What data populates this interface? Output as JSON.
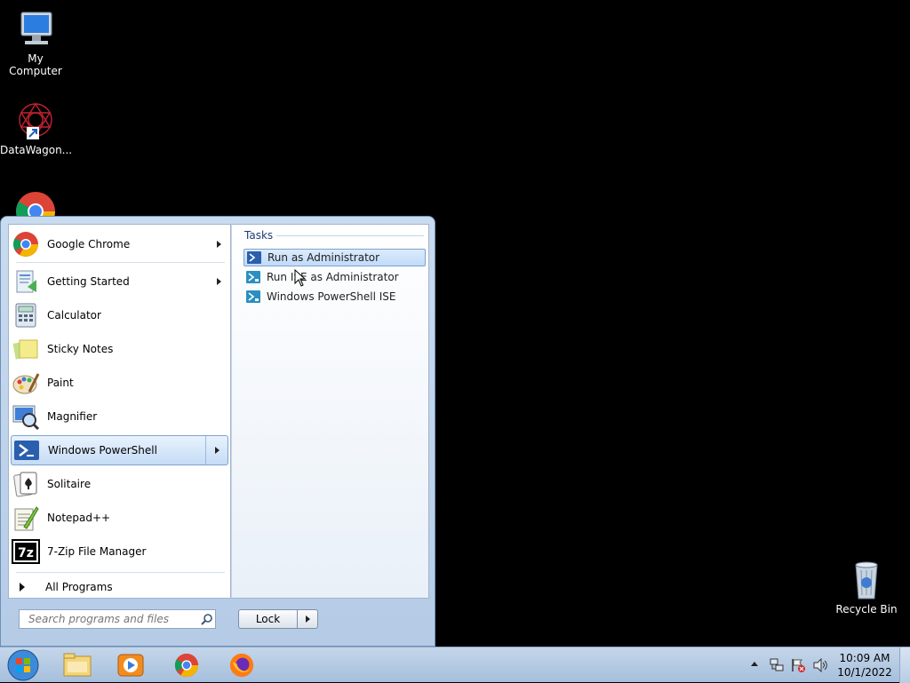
{
  "desktop": {
    "icons": [
      {
        "label": "My Computer",
        "icon": "computer-icon"
      },
      {
        "label": "DataWagon...",
        "icon": "datawagon-icon"
      },
      {
        "label": "Recycle Bin",
        "icon": "recycle-bin-icon"
      }
    ]
  },
  "start_menu": {
    "programs": [
      {
        "label": "Google Chrome",
        "icon": "chrome-icon",
        "has_submenu": true
      },
      {
        "label": "Getting Started",
        "icon": "getting-started-icon",
        "has_submenu": true
      },
      {
        "label": "Calculator",
        "icon": "calculator-icon"
      },
      {
        "label": "Sticky Notes",
        "icon": "sticky-notes-icon"
      },
      {
        "label": "Paint",
        "icon": "paint-icon"
      },
      {
        "label": "Magnifier",
        "icon": "magnifier-icon"
      },
      {
        "label": "Windows PowerShell",
        "icon": "powershell-icon",
        "has_submenu": true,
        "selected": true
      },
      {
        "label": "Solitaire",
        "icon": "solitaire-icon"
      },
      {
        "label": "Notepad++",
        "icon": "notepadpp-icon"
      },
      {
        "label": "7-Zip File Manager",
        "icon": "7zip-icon"
      }
    ],
    "all_programs_label": "All Programs",
    "search_placeholder": "Search programs and files",
    "lock_label": "Lock",
    "tasks_heading": "Tasks",
    "tasks": [
      {
        "label": "Run as Administrator",
        "icon": "powershell-icon",
        "selected": true
      },
      {
        "label": "Run ISE as Administrator",
        "icon": "powershell-ise-icon"
      },
      {
        "label": "Windows PowerShell ISE",
        "icon": "powershell-ise-icon"
      }
    ]
  },
  "taskbar": {
    "items": [
      "windows-orb-icon",
      "file-explorer-icon",
      "media-player-icon",
      "chrome-icon",
      "firefox-icon"
    ],
    "clock_time": "10:09 AM",
    "clock_date": "10/1/2022",
    "colors": {
      "accent": "#c4dcf6",
      "taskbar": "#b5cbe6"
    }
  }
}
